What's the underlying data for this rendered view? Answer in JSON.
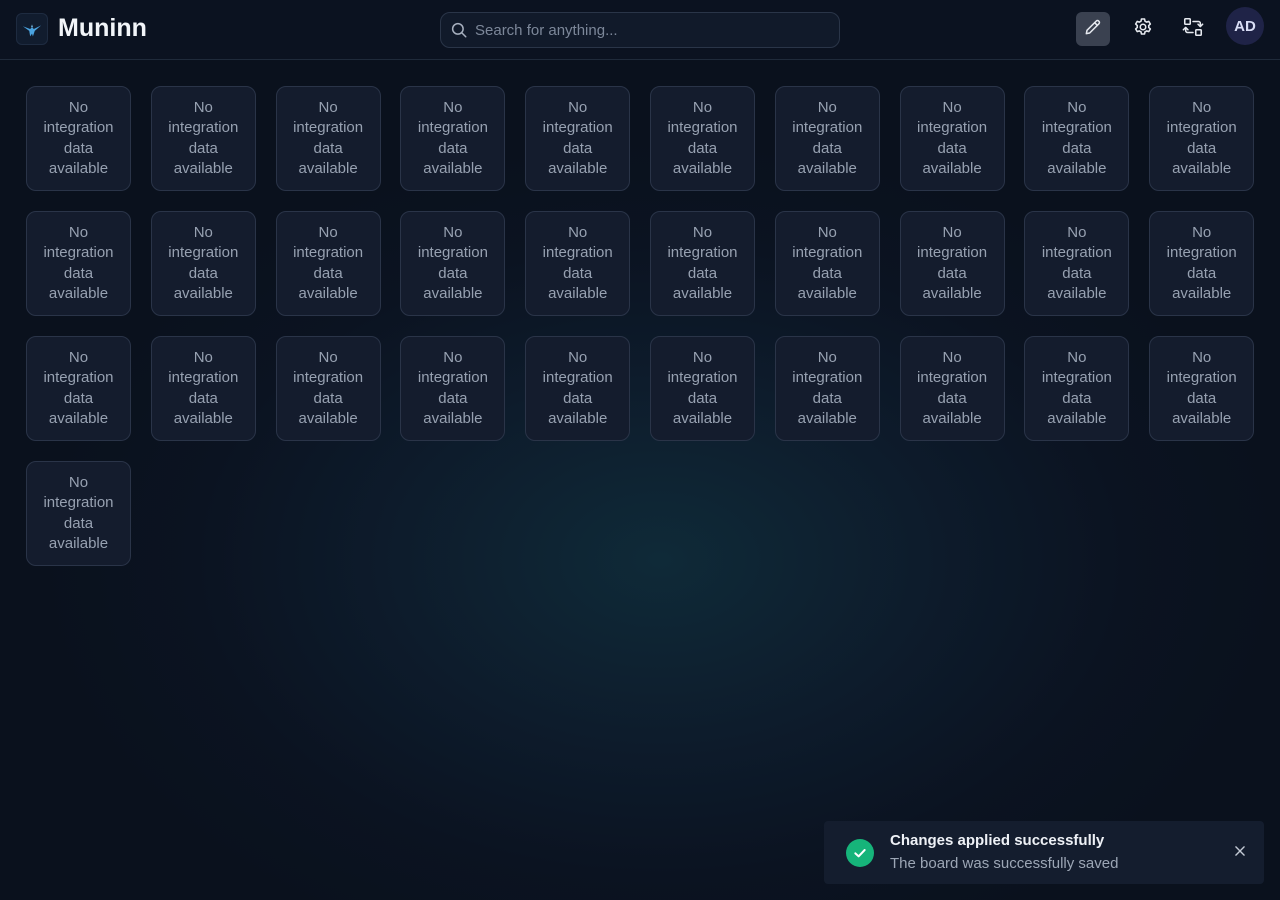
{
  "header": {
    "app_title": "Muninn",
    "logo_icon": "raven-logo-icon",
    "search": {
      "placeholder": "Search for anything...",
      "value": "",
      "icon": "search-icon"
    },
    "actions": [
      {
        "name": "edit-mode-button",
        "icon": "pencil-icon",
        "active": true
      },
      {
        "name": "settings-button",
        "icon": "gear-icon",
        "active": false
      },
      {
        "name": "switch-board-button",
        "icon": "arrows-swap-icon",
        "active": false
      }
    ],
    "user": {
      "initials": "AD"
    }
  },
  "board": {
    "tiles": [
      {
        "text": "No integration data available"
      },
      {
        "text": "No integration data available"
      },
      {
        "text": "No integration data available"
      },
      {
        "text": "No integration data available"
      },
      {
        "text": "No integration data available"
      },
      {
        "text": "No integration data available"
      },
      {
        "text": "No integration data available"
      },
      {
        "text": "No integration data available"
      },
      {
        "text": "No integration data available"
      },
      {
        "text": "No integration data available"
      },
      {
        "text": "No integration data available"
      },
      {
        "text": "No integration data available"
      },
      {
        "text": "No integration data available"
      },
      {
        "text": "No integration data available"
      },
      {
        "text": "No integration data available"
      },
      {
        "text": "No integration data available"
      },
      {
        "text": "No integration data available"
      },
      {
        "text": "No integration data available"
      },
      {
        "text": "No integration data available"
      },
      {
        "text": "No integration data available"
      },
      {
        "text": "No integration data available"
      },
      {
        "text": "No integration data available"
      },
      {
        "text": "No integration data available"
      },
      {
        "text": "No integration data available"
      },
      {
        "text": "No integration data available"
      },
      {
        "text": "No integration data available"
      },
      {
        "text": "No integration data available"
      },
      {
        "text": "No integration data available"
      },
      {
        "text": "No integration data available"
      },
      {
        "text": "No integration data available"
      },
      {
        "text": "No integration data available"
      }
    ]
  },
  "toast": {
    "status": "success",
    "status_color": "#16b47a",
    "icon": "check-icon",
    "title": "Changes applied successfully",
    "message": "The board was successfully saved",
    "close_icon": "close-icon"
  },
  "colors": {
    "background": "#0b1321",
    "header": "#0b1220",
    "tile": "#141c2d",
    "accent_logo": "#4aa3e0"
  }
}
